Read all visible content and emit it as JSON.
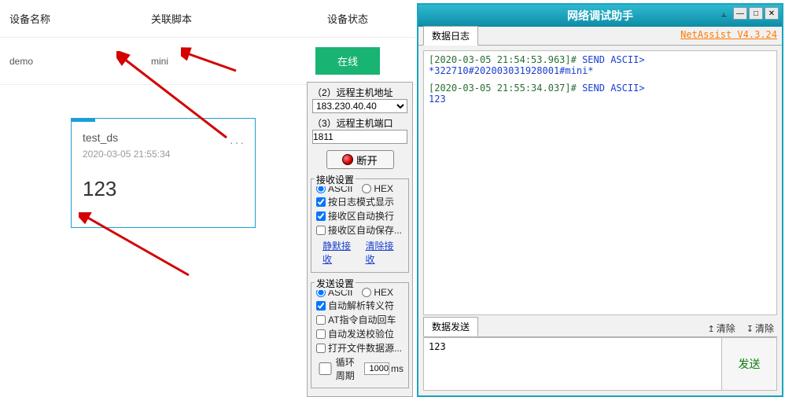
{
  "table": {
    "headers": {
      "name": "设备名称",
      "script": "关联脚本",
      "status": "设备状态"
    },
    "row": {
      "name": "demo",
      "script": "mini",
      "status": "在线"
    }
  },
  "card": {
    "title": "test_ds",
    "time": "2020-03-05 21:55:34",
    "value": "123"
  },
  "mid": {
    "section_host_header": "（2）远程主机地址",
    "host_value": "183.230.40.40",
    "port_label": "（3）远程主机端口",
    "port_value": "1811",
    "disconnect": "断开",
    "recv_header": "接收设置",
    "ascii": "ASCII",
    "hex": "HEX",
    "log_mode": "按日志模式显示",
    "auto_wrap": "接收区自动换行",
    "auto_save": "接收区自动保存...",
    "link_pause": "静默接收",
    "link_clear": "清除接收",
    "send_header": "发送设置",
    "escape": "自动解析转义符",
    "at_cr": "AT指令自动回车",
    "auto_checksum": "自动发送校验位",
    "open_file": "打开文件数据源...",
    "cycle_label": "循环周期",
    "cycle_value": "1000",
    "cycle_unit": "ms"
  },
  "na": {
    "title": "网络调试助手",
    "brand": "NetAssist V4.3.24",
    "tab_log": "数据日志",
    "log": {
      "l1_meta": "[2020-03-05 21:54:53.963]# ",
      "l1_cmd": "SEND ASCII>",
      "l1_pay": "*322710#202003031928001#mini*",
      "l2_meta": "[2020-03-05 21:55:34.037]# ",
      "l2_cmd": "SEND ASCII>",
      "l2_pay": "123"
    },
    "tab_send": "数据发送",
    "clear_up": "清除",
    "clear_down": "清除",
    "input_value": "123",
    "send_btn": "发送"
  }
}
